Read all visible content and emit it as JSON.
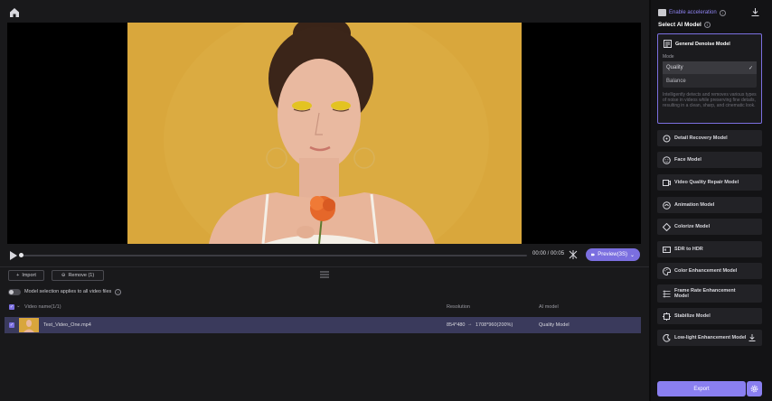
{
  "colors": {
    "accent": "#7b6fe0",
    "accent_text": "#8f84f2",
    "selected_row": "#3a3a5c",
    "photo_bg": "#d8a63c"
  },
  "player": {
    "time": "00:00 / 00:05",
    "preview_label": "Preview(3S)",
    "progress": 0
  },
  "toolbar": {
    "import_label": "Import",
    "remove_label": "Remove (1)"
  },
  "option": {
    "apply_all_label": "Model selection applies to all video files"
  },
  "table": {
    "headers": {
      "name": "Video name(1/1)",
      "resolution": "Resolution",
      "ai_model": "AI model"
    },
    "rows": [
      {
        "name": "Test_Video_One.mp4",
        "resolution_from": "854*480",
        "resolution_to": "1708*960(200%)",
        "model": "Quality Model"
      }
    ]
  },
  "panel": {
    "enable_acceleration": "Enable acceleration",
    "select_model_title": "Select AI Model",
    "active_model": {
      "title": "General Denoise Model",
      "mode_label": "Mode",
      "modes": [
        "Quality",
        "Balance"
      ],
      "selected_mode": "Quality",
      "description": "Intelligently detects and removes various types of noise in videos while preserving fine details, resulting in a clean, sharp, and cinematic look."
    },
    "models": [
      {
        "label": "Detail Recovery Model",
        "icon": "detail-icon"
      },
      {
        "label": "Face Model",
        "icon": "face-icon"
      },
      {
        "label": "Video Quality Repair Model",
        "icon": "repair-icon"
      },
      {
        "label": "Animation Model",
        "icon": "animation-icon"
      },
      {
        "label": "Colorize Model",
        "icon": "colorize-icon"
      },
      {
        "label": "SDR to HDR",
        "icon": "hdr-icon"
      },
      {
        "label": "Color Enhancement Model",
        "icon": "palette-icon"
      },
      {
        "label": "Frame Rate Enhancement Model",
        "icon": "frame-rate-icon"
      },
      {
        "label": "Stabilize Model",
        "icon": "stabilize-icon"
      },
      {
        "label": "Low-light Enhancement Model",
        "icon": "lowlight-icon"
      }
    ],
    "export_label": "Export"
  }
}
